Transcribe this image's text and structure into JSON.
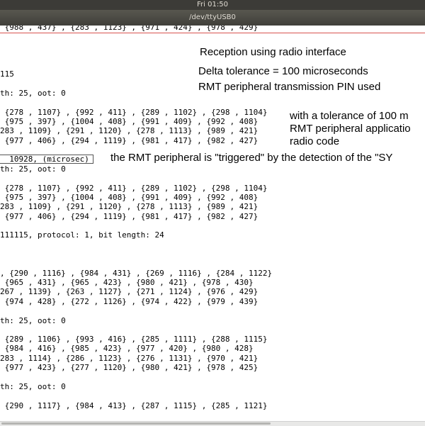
{
  "topbar": {
    "clock": "Fri 01:50"
  },
  "window": {
    "title": "/dev/ttyUSB0"
  },
  "terminal": {
    "cut_top": " {988 , 437} , {283 , 1123} , {971 , 424} , {978 , 429}",
    "lines": [
      "115",
      "th: 25, oot: 0",
      " {278 , 1107} , {992 , 411} , {289 , 1102} , {298 , 1104}",
      " {975 , 397} , {1004 , 408} , {991 , 409} , {992 , 408}",
      "283 , 1109} , {291 , 1120} , {278 , 1113} , {989 , 421}",
      " {977 , 406} , {294 , 1119} , {981 , 417} , {982 , 427}",
      "  10928, (microsec)",
      "th: 25, oot: 0",
      " {278 , 1107} , {992 , 411} , {289 , 1102} , {298 , 1104}",
      " {975 , 397} , {1004 , 408} , {991 , 409} , {992 , 408}",
      "283 , 1109} , {291 , 1120} , {278 , 1113} , {989 , 421}",
      " {977 , 406} , {294 , 1119} , {981 , 417} , {982 , 427}",
      "111115, protocol: 1, bit length: 24",
      ", {290 , 1116} , {984 , 431} , {269 , 1116} , {284 , 1122}",
      " {965 , 431} , {965 , 423} , {980 , 421} , {978 , 430}",
      "267 , 1139} , {263 , 1127} , {271 , 1124} , {976 , 429}",
      " {974 , 428} , {272 , 1126} , {974 , 422} , {979 , 439}",
      "th: 25, oot: 0",
      " {289 , 1106} , {993 , 416} , {285 , 1111} , {288 , 1115}",
      " {984 , 416} , {985 , 423} , {977 , 420} , {980 , 428}",
      "283 , 1114} , {286 , 1123} , {276 , 1131} , {970 , 421}",
      " {977 , 423} , {277 , 1120} , {980 , 421} , {978 , 425}",
      "th: 25, oot: 0",
      " {290 , 1117} , {984 , 413} , {287 , 1115} , {285 , 1121}"
    ]
  },
  "annotations": {
    "reception": "Reception using radio interface",
    "delta": "Delta tolerance = 100 microseconds",
    "rmt_pin": "RMT peripheral transmission PIN used",
    "tolerance_1": "with a tolerance of 100 m",
    "tolerance_2": "RMT peripheral applicatio",
    "tolerance_3": "radio code",
    "triggered": "the RMT peripheral is \"triggered\" by the detection of the \"SY"
  }
}
